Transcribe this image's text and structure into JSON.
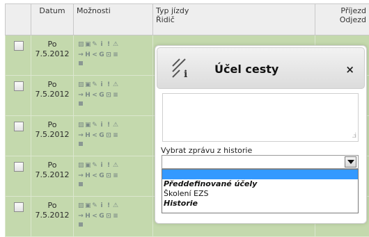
{
  "table": {
    "headers": {
      "date": "Datum",
      "options": "Možnosti",
      "type_line1": "Typ jízdy",
      "type_line2": "Řidič",
      "arrival_line1": "Příjezd",
      "arrival_line2": "Odjezd"
    },
    "rows": [
      {
        "day": "Po",
        "date": "7.5.2012"
      },
      {
        "day": "Po",
        "date": "7.5.2012"
      },
      {
        "day": "Po",
        "date": "7.5.2012"
      },
      {
        "day": "Po",
        "date": "7.5.2012"
      },
      {
        "day": "Po",
        "date": "7.5.2012"
      }
    ],
    "icon_glyphs_row1": [
      "▨",
      "▣",
      "✎",
      "i",
      "!",
      "⚠"
    ],
    "icon_glyphs_row2": [
      "→",
      "H",
      "<",
      "G",
      "⊡",
      "≡"
    ]
  },
  "dialog": {
    "title": "Účel cesty",
    "close": "×",
    "history_label": "Vybrat zprávu z historie",
    "select_value": "",
    "dropdown_items": [
      {
        "label": ""
      },
      {
        "label": "Předdefinované účely"
      },
      {
        "label": "Školení EZS"
      },
      {
        "label": "Historie"
      }
    ]
  }
}
